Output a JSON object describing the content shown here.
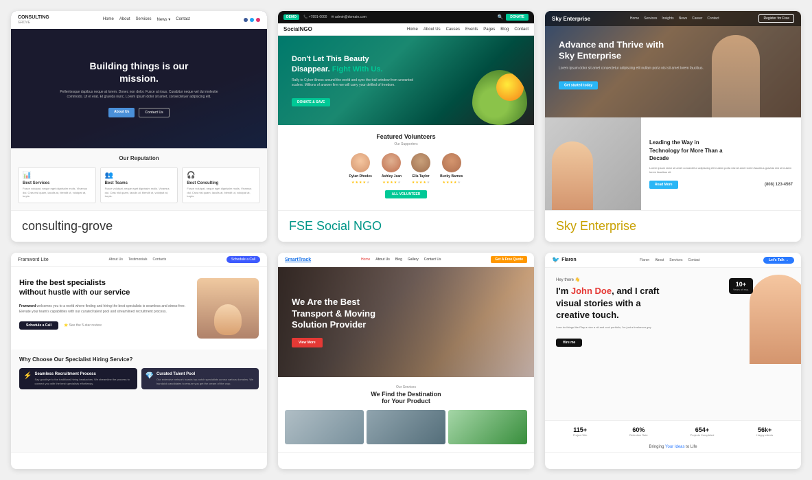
{
  "cards": [
    {
      "id": "consulting-grove",
      "label": "ConsultingGrove",
      "label_class": "",
      "nav": {
        "logo": "CONSULTING",
        "logo_sub": "GROVE",
        "links": [
          "Home",
          "About",
          "Services",
          "News",
          "Contact"
        ]
      },
      "hero": {
        "title": "Building things is our\nmission.",
        "subtitle_lines": [
          "Pellentesque dapibus neque at lorem. Donec non dolor. Fusce at risus. Curabitur neque.",
          "vel dui molestie commodo. Ut et erat. Etgravida nunc. Lorem ipsum dolor sit amet,",
          "consectetuer adipiscing elit."
        ],
        "btn_primary": "About Us",
        "btn_outline": "Contact Us"
      },
      "reputation": {
        "title": "Our Reputation",
        "cards": [
          {
            "icon": "📊",
            "title": "Best Services",
            "text": "Fusce volutpat, neque eget dignissim molis. Vivamus dui. Cras nisl quam, iaculis at, blendit ut, volutpat at, turpis."
          },
          {
            "icon": "👥",
            "title": "Best Teams",
            "text": "Fusce volutpat, neque eget dignissim molis. Vivamus dui. Cras nisl quam, iaculis at, blendit ut, volutpat at, turpis."
          },
          {
            "icon": "🎧",
            "title": "Best Consulting",
            "text": "Fusce volutpat, neque eget dignissim molis. Vivamus dui. Cras nisl quam, iaculis at, blendit ut, volutpat at, turpis."
          }
        ]
      }
    },
    {
      "id": "fse-social-ngo",
      "label": "FSE Social NGO",
      "label_class": "teal",
      "nav_top": {
        "phone": "📞 +7891-0000",
        "email": "✉ admin@domain.com",
        "demo_label": "DEMO"
      },
      "nav_main": {
        "logo": "SocialNGO",
        "links": [
          "Home",
          "About Us",
          "Causes",
          "Events",
          "Pages",
          "Blog",
          "Contact"
        ]
      },
      "hero": {
        "title": "Don't Let This Beauty\nDisappear. Fight With Us.",
        "subtitle": "Rally to Cyber illness around the world and sync the trail window from unwanted scalers. Millions of answer firm we will carry your defiled of freedom.",
        "btn": "DONATE & SAVE"
      },
      "featured": {
        "title": "Featured Volunteers",
        "subtitle": "Our Supporters",
        "volunteers": [
          {
            "name": "Dylan Rhodes",
            "stars": 4
          },
          {
            "name": "Ashley Jean",
            "stars": 4
          },
          {
            "name": "Ella Taylor",
            "stars": 4
          },
          {
            "name": "Bucky Barnes",
            "stars": 4
          }
        ],
        "all_btn": "ALL VOLUNTEER"
      }
    },
    {
      "id": "sky-enterprise",
      "label": "Sky Enterprise",
      "label_class": "gold",
      "nav": {
        "logo": "Sky Enterprise",
        "links": [
          "Home",
          "Services",
          "Insights",
          "News",
          "Career",
          "Contact"
        ],
        "btn": "Register for Free"
      },
      "hero": {
        "title": "Advance and Thrive with\nSky Enterprise",
        "subtitle": "Lorem ipsum dolor sit amet consectetur adipiscing elit nullam porta nisi sit amet lorem faucibus a gravida sapien.",
        "btn": "Get started today"
      },
      "lower": {
        "title": "Leading the Way in\nTechnology for More Than a\nDecade",
        "text": "Lorem ipsum dolor sit amet consectetur adipiscing elit nullam porta nisi sit amet lorem faucibus gravida nisi sit nullam lorem faucibus sit.",
        "btn": "Read More",
        "phone": "(808) 123-4567"
      }
    },
    {
      "id": "framework-lite",
      "label": "",
      "label_class": "",
      "nav": {
        "logo": "Framword Lite",
        "links": [
          "About Us",
          "Testimonials",
          "Contacts"
        ],
        "btn": "Schedule a Call"
      },
      "hero": {
        "title": "Hire the best specialists\nwithout hustle with our service",
        "intro": "Framword",
        "text": " welcomes you to a world where finding and hiring the best specialists is seamless and stress-free. Elevate your team's capabilities with our curated talent pool and streamlined recruitment process.",
        "btn": "Schedule a Call",
        "review": "⭐ See the 5-star review from..."
      },
      "why": {
        "title": "Why Choose Our Specialist Hiring Service?",
        "cards": [
          {
            "icon": "⚡",
            "title": "Seamless Recruitment Process",
            "text": "Say goodbye to the traditional hiring headaches. We streamline the process to connect you with the best specialists effortlessly."
          },
          {
            "icon": "💎",
            "title": "Curated Talent Pool",
            "text": "Our extensive network boasts top-notch specialists across various domains. We handpick candidates to ensure you get the cream of the crop."
          }
        ]
      }
    },
    {
      "id": "smarttrack",
      "label": "",
      "label_class": "",
      "nav": {
        "logo": "SmartTrack",
        "links": [
          "Home",
          "About Us",
          "Blog",
          "Gallery",
          "Contact Us"
        ],
        "btn": "Get A Free Quote"
      },
      "hero": {
        "title": "We Are the Best\nTransport & Moving\nSolution Provider",
        "btn": "View More"
      },
      "services": {
        "label": "Our Services",
        "title": "We Find the Destination\nfor Your Product"
      }
    },
    {
      "id": "flaron",
      "label": "",
      "label_class": "",
      "nav": {
        "logo": "Flaron",
        "logo_icon": "🐦",
        "links": [
          "Flaron",
          "About",
          "Services",
          "Contact"
        ],
        "btn": "Let's Talk →"
      },
      "hero": {
        "hey": "Hey there 👋",
        "title": "I'm John Doe, and I craft\nvisual stories with a\ncreative touch.",
        "highlight": "John Doe",
        "subtitle": "I can do things like Play a nice a nit and cool portfolio, I'm just a freelancer guy",
        "btn": "Hire me"
      },
      "badge": {
        "num": "10+",
        "label": "Years of exp."
      },
      "stats": [
        {
          "num": "115+",
          "label": "Project Win"
        },
        {
          "num": "60%",
          "label": "Retention Rate"
        },
        {
          "num": "654+",
          "label": "Projects Completed"
        },
        {
          "num": "56k+",
          "label": "Happy clients"
        }
      ],
      "footer": "Bringing Your Ideas to Life"
    }
  ]
}
